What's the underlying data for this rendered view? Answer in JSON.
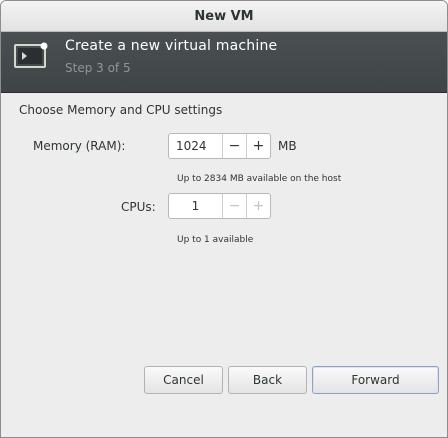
{
  "window": {
    "title": "New VM"
  },
  "header": {
    "title": "Create a new virtual machine",
    "step": "Step 3 of 5"
  },
  "page": {
    "section_title": "Choose Memory and CPU settings"
  },
  "memory": {
    "label": "Memory (RAM):",
    "value": "1024",
    "decrement": "−",
    "increment": "+",
    "unit": "MB",
    "hint": "Up to 2834 MB available on the host"
  },
  "cpus": {
    "label": "CPUs:",
    "value": "1",
    "decrement": "−",
    "increment": "+",
    "hint": "Up to 1 available"
  },
  "buttons": {
    "cancel": "Cancel",
    "back": "Back",
    "forward": "Forward"
  },
  "icons": {
    "header": "vm-monitor-icon"
  },
  "colors": {
    "header_bg": "#454a4d",
    "header_text": "#ffffff",
    "step_text": "#8f9598",
    "window_bg": "#ededed"
  }
}
